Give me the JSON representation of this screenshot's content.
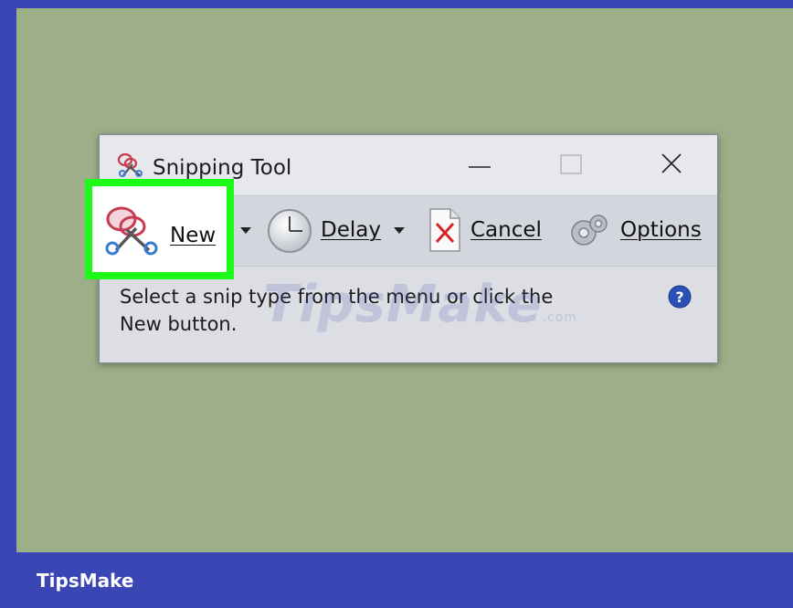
{
  "window": {
    "title": "Snipping Tool",
    "title_icon": "scissors-icon",
    "controls": [
      "minimize-icon",
      "maximize-icon",
      "close-icon"
    ]
  },
  "toolbar": {
    "new_label": "New",
    "delay_label": "Delay",
    "cancel_label": "Cancel",
    "options_label": "Options"
  },
  "status": {
    "line1": "Select a snip type from the menu or click the",
    "line2": "New button."
  },
  "watermark": {
    "text": "TipsMake",
    "suffix": ".com"
  },
  "footer": {
    "brand": "TipsMake"
  },
  "colors": {
    "desktop": "#9daf89",
    "frame": "#3b46b5",
    "highlight": "#1dfa17",
    "help": "#2a4fb8",
    "cancel_x": "#d8232a"
  }
}
